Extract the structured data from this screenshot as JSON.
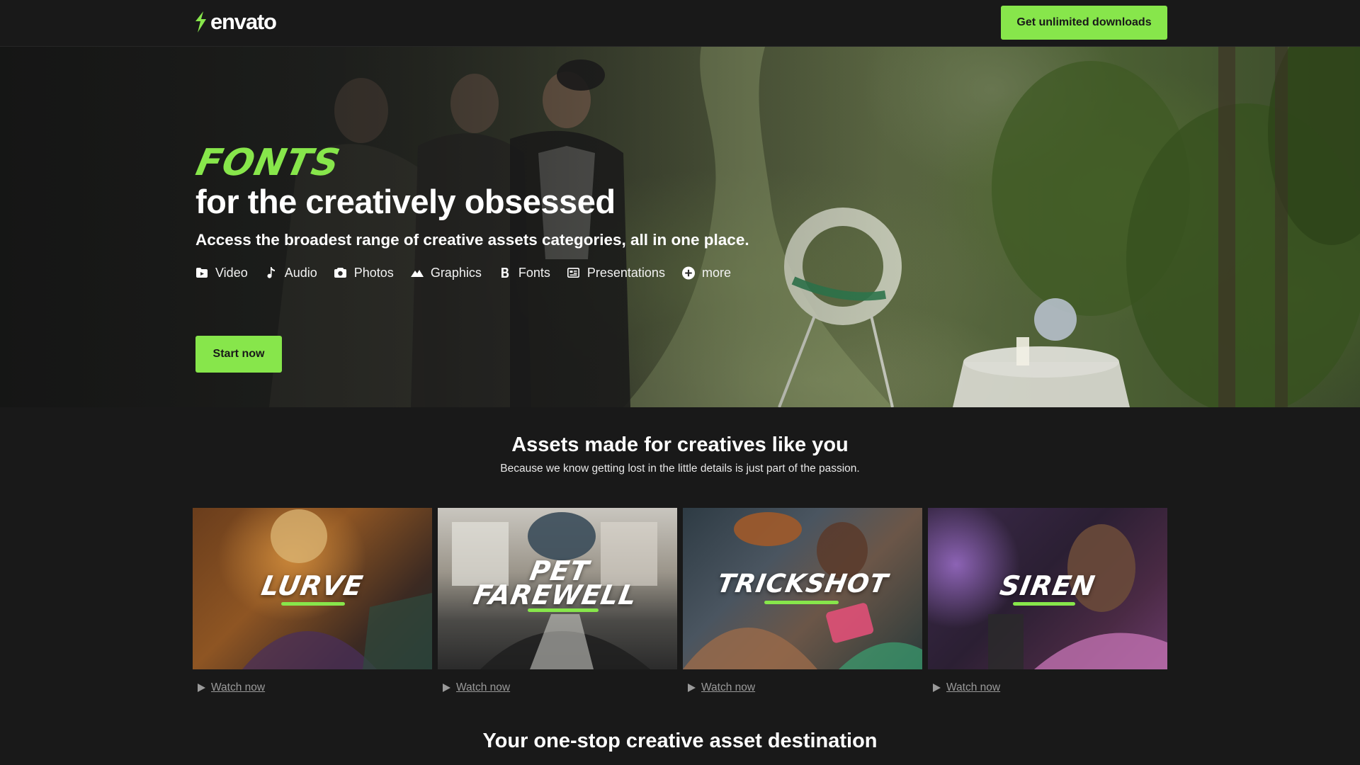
{
  "header": {
    "logo_text": "envato",
    "cta_label": "Get unlimited downloads"
  },
  "hero": {
    "kicker": "FONTS",
    "title": "for the creatively obsessed",
    "subtitle": "Access the broadest range of creative assets categories, all in one place.",
    "categories": [
      {
        "label": "Video",
        "icon": "folder-icon"
      },
      {
        "label": "Audio",
        "icon": "music-note-icon"
      },
      {
        "label": "Photos",
        "icon": "camera-icon"
      },
      {
        "label": "Graphics",
        "icon": "mountain-icon"
      },
      {
        "label": "Fonts",
        "icon": "bold-b-icon"
      },
      {
        "label": "Presentations",
        "icon": "presentation-icon"
      },
      {
        "label": "more",
        "icon": "plus-circle-icon"
      }
    ],
    "start_label": "Start now"
  },
  "assets": {
    "title": "Assets made for creatives like you",
    "subtitle": "Because we know getting lost in the little details is just part of the passion.",
    "cards": [
      {
        "title": "LURVE",
        "watch_label": "Watch now"
      },
      {
        "title": "PET FAREWELL",
        "title_line1": "PET",
        "title_line2": "FAREWELL",
        "watch_label": "Watch now"
      },
      {
        "title": "TRICKSHOT",
        "watch_label": "Watch now"
      },
      {
        "title": "SIREN",
        "watch_label": "Watch now"
      }
    ]
  },
  "destination": {
    "title": "Your one-stop creative asset destination"
  },
  "colors": {
    "accent": "#87e64b",
    "background": "#191919",
    "text": "#ffffff",
    "muted": "#9a9a9a"
  }
}
